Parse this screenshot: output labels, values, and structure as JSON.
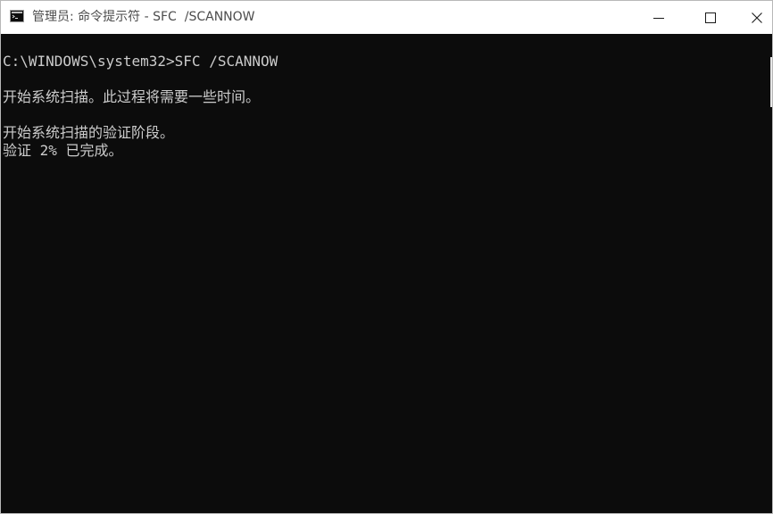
{
  "window": {
    "title": "管理员: 命令提示符 - SFC  /SCANNOW"
  },
  "titlebar": {
    "app_icon": "cmd-icon",
    "minimize_icon": "minimize-icon",
    "maximize_icon": "maximize-icon",
    "close_icon": "close-icon"
  },
  "console": {
    "lines": [
      "C:\\WINDOWS\\system32>SFC /SCANNOW",
      "开始系统扫描。此过程将需要一些时间。",
      "开始系统扫描的验证阶段。",
      "验证 2% 已完成。"
    ],
    "text_color": "#cccccc",
    "background_color": "#0c0c0c"
  }
}
